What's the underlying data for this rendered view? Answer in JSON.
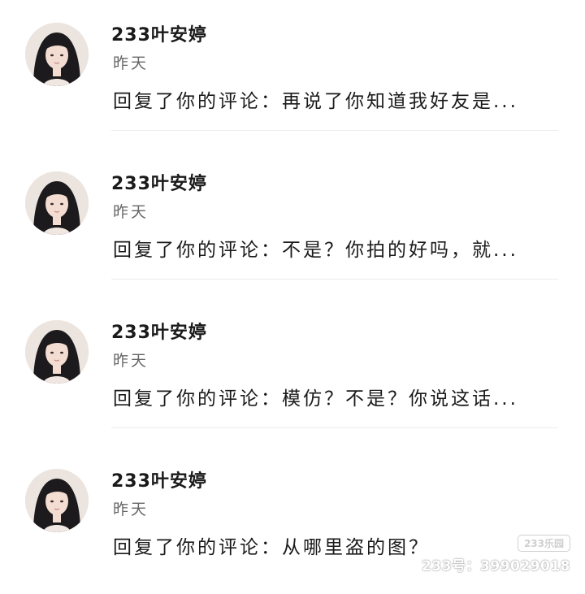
{
  "notifications": [
    {
      "username": "233叶安婷",
      "time": "昨天",
      "reply": "回复了你的评论：再说了你知道我好友是..."
    },
    {
      "username": "233叶安婷",
      "time": "昨天",
      "reply": "回复了你的评论：不是？你拍的好吗，就..."
    },
    {
      "username": "233叶安婷",
      "time": "昨天",
      "reply": "回复了你的评论：模仿？不是？你说这话..."
    },
    {
      "username": "233叶安婷",
      "time": "昨天",
      "reply": "回复了你的评论：从哪里盗的图？"
    }
  ],
  "watermark": {
    "logo": "233乐园",
    "id_text": "233号：399029018"
  }
}
